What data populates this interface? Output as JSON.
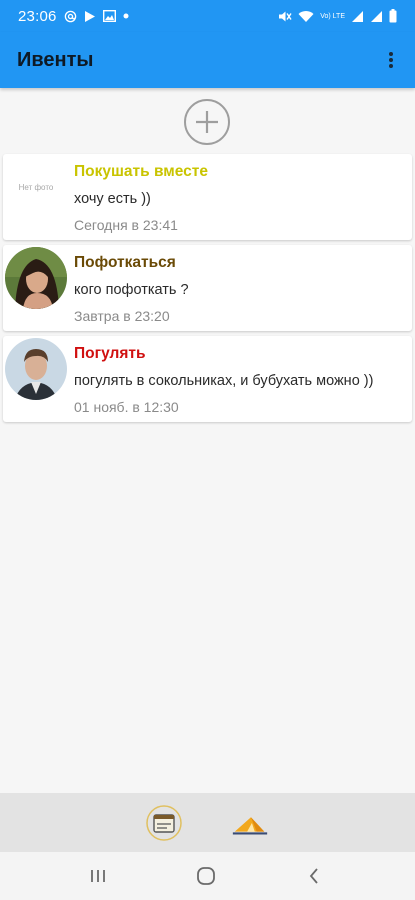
{
  "status_bar": {
    "time": "23:06",
    "left_icons": [
      "at-sign-icon",
      "play-store-icon",
      "image-icon",
      "dot-icon"
    ],
    "right_icons": [
      "mute-icon",
      "wifi-icon",
      "signal-icon",
      "signal-icon",
      "battery-icon"
    ],
    "volte_label": "Vo) LTE"
  },
  "app_bar": {
    "title": "Ивенты",
    "menu_icon": "more-vert-icon",
    "color": "#2196f3"
  },
  "add_button": {
    "icon": "plus-icon"
  },
  "events": [
    {
      "title": "Покушать вместе",
      "title_color": "#c9c400",
      "text": "хочу есть ))",
      "date": "Сегодня в 23:41",
      "avatar": "no-photo",
      "no_photo_label": "Нет фото"
    },
    {
      "title": "Пофоткаться",
      "title_color": "#6a4a06",
      "text": "кого пофоткать ?",
      "date": "Завтра в 23:20",
      "avatar": "woman-photo"
    },
    {
      "title": "Погулять",
      "title_color": "#d01010",
      "text": "погулять в сокольниках, и бубухать можно ))",
      "date": "01 нояб. в 12:30",
      "avatar": "man-photo"
    }
  ],
  "bottom_tabs": [
    {
      "icon": "calendar-icon",
      "selected": true
    },
    {
      "icon": "tent-icon",
      "selected": false
    }
  ],
  "nav_bar": {
    "buttons": [
      "recent-apps-icon",
      "home-icon",
      "back-icon"
    ]
  }
}
